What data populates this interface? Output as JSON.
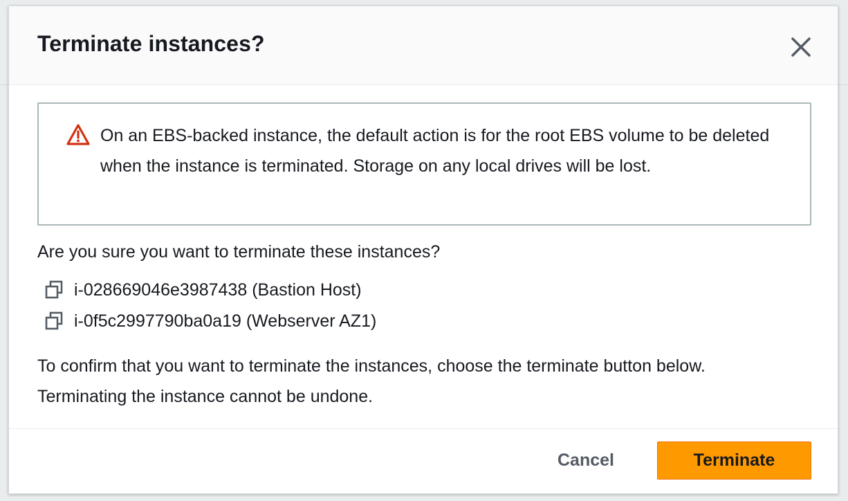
{
  "dialog": {
    "title": "Terminate instances?",
    "close_icon": "close-icon"
  },
  "alert": {
    "icon": "warning-icon",
    "icon_color": "#d13212",
    "message": "On an EBS-backed instance, the default action is for the root EBS volume to be deleted when the instance is terminated. Storage on any local drives will be lost."
  },
  "question": "Are you sure you want to terminate these instances?",
  "instances": [
    {
      "icon": "copy-icon",
      "label": "i-028669046e3987438 (Bastion Host)"
    },
    {
      "icon": "copy-icon",
      "label": "i-0f5c2997790ba0a19 (Webserver AZ1)"
    }
  ],
  "confirm_text": "To confirm that you want to terminate the instances, choose the terminate button below. Terminating the instance cannot be undone.",
  "footer": {
    "cancel_label": "Cancel",
    "terminate_label": "Terminate",
    "terminate_color": "#ff9900"
  }
}
